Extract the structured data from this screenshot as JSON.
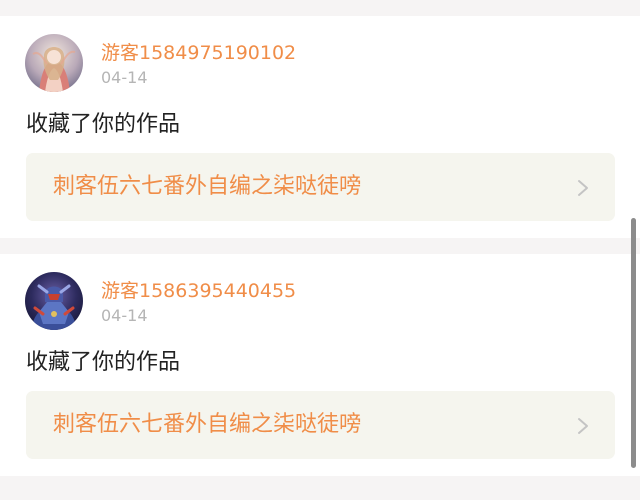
{
  "activity": [
    {
      "username": "游客1584975190102",
      "date": "04-14",
      "action": "收藏了你的作品",
      "work_title": "刺客伍六七番外自编之柒哒徒嗙",
      "avatar_icon": "anime-girl-avatar-icon",
      "chevron_icon": "chevron-right-icon"
    },
    {
      "username": "游客1586395440455",
      "date": "04-14",
      "action": "收藏了你的作品",
      "work_title": "刺客伍六七番外自编之柒哒徒嗙",
      "avatar_icon": "armored-hero-avatar-icon",
      "chevron_icon": "chevron-right-icon"
    }
  ],
  "colors": {
    "accent": "#f08d48",
    "background": "#f6f4f4",
    "card": "#ffffff",
    "link_box": "#f5f5ee",
    "date": "#b5b5b5",
    "text": "#222222"
  }
}
